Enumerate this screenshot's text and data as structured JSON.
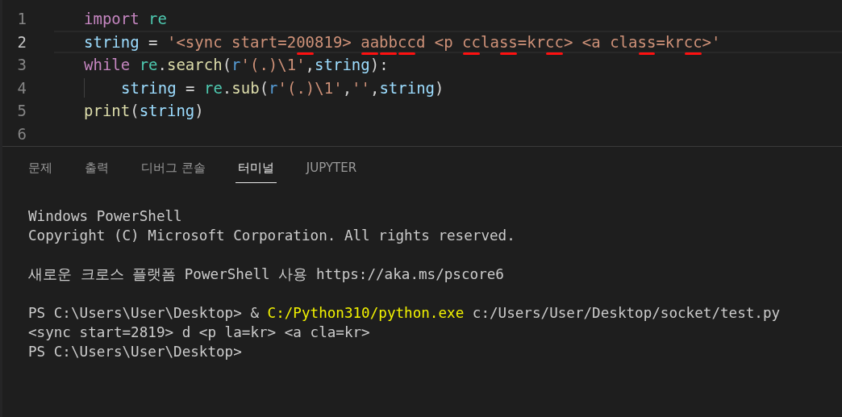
{
  "editor": {
    "lines": [
      {
        "number": "1",
        "current": false,
        "tokens": [
          {
            "text": "import ",
            "kind": "keyword",
            "marked": false
          },
          {
            "text": "re",
            "kind": "module",
            "marked": false
          }
        ]
      },
      {
        "number": "2",
        "current": true,
        "tokens": [
          {
            "text": "string",
            "kind": "variable",
            "marked": false
          },
          {
            "text": " = ",
            "kind": "plain",
            "marked": false
          },
          {
            "text": "'<sync start=2",
            "kind": "string",
            "marked": false
          },
          {
            "text": "00",
            "kind": "string",
            "marked": true
          },
          {
            "text": "819> ",
            "kind": "string",
            "marked": false
          },
          {
            "text": "aa",
            "kind": "string",
            "marked": true
          },
          {
            "text": "bb",
            "kind": "string",
            "marked": true
          },
          {
            "text": "cc",
            "kind": "string",
            "marked": true
          },
          {
            "text": "d <p ",
            "kind": "string",
            "marked": false
          },
          {
            "text": "cc",
            "kind": "string",
            "marked": true
          },
          {
            "text": "la",
            "kind": "string",
            "marked": false
          },
          {
            "text": "ss",
            "kind": "string",
            "marked": true
          },
          {
            "text": "=kr",
            "kind": "string",
            "marked": false
          },
          {
            "text": "cc",
            "kind": "string",
            "marked": true
          },
          {
            "text": "> <a cla",
            "kind": "string",
            "marked": false
          },
          {
            "text": "ss",
            "kind": "string",
            "marked": true
          },
          {
            "text": "=kr",
            "kind": "string",
            "marked": false
          },
          {
            "text": "cc",
            "kind": "string",
            "marked": true
          },
          {
            "text": ">'",
            "kind": "string",
            "marked": false
          }
        ]
      },
      {
        "number": "3",
        "current": false,
        "tokens": [
          {
            "text": "while ",
            "kind": "keyword",
            "marked": false
          },
          {
            "text": "re",
            "kind": "module",
            "marked": false
          },
          {
            "text": ".",
            "kind": "plain",
            "marked": false
          },
          {
            "text": "search",
            "kind": "function",
            "marked": false
          },
          {
            "text": "(",
            "kind": "plain",
            "marked": false
          },
          {
            "text": "r",
            "kind": "prefix",
            "marked": false
          },
          {
            "text": "'(.)\\1'",
            "kind": "string",
            "marked": false
          },
          {
            "text": ",",
            "kind": "plain",
            "marked": false
          },
          {
            "text": "string",
            "kind": "variable",
            "marked": false
          },
          {
            "text": "):",
            "kind": "plain",
            "marked": false
          }
        ],
        "children": [
          {
            "number": "4",
            "current": false,
            "tokens": [
              {
                "text": "string",
                "kind": "variable",
                "marked": false
              },
              {
                "text": " = ",
                "kind": "plain",
                "marked": false
              },
              {
                "text": "re",
                "kind": "module",
                "marked": false
              },
              {
                "text": ".",
                "kind": "plain",
                "marked": false
              },
              {
                "text": "sub",
                "kind": "function",
                "marked": false
              },
              {
                "text": "(",
                "kind": "plain",
                "marked": false
              },
              {
                "text": "r",
                "kind": "prefix",
                "marked": false
              },
              {
                "text": "'(.)\\1'",
                "kind": "string",
                "marked": false
              },
              {
                "text": ",",
                "kind": "plain",
                "marked": false
              },
              {
                "text": "''",
                "kind": "string",
                "marked": false
              },
              {
                "text": ",",
                "kind": "plain",
                "marked": false
              },
              {
                "text": "string",
                "kind": "variable",
                "marked": false
              },
              {
                "text": ")",
                "kind": "plain",
                "marked": false
              }
            ]
          }
        ]
      },
      {
        "number": "5",
        "current": false,
        "tokens": [
          {
            "text": "print",
            "kind": "function",
            "marked": false
          },
          {
            "text": "(",
            "kind": "plain",
            "marked": false
          },
          {
            "text": "string",
            "kind": "variable",
            "marked": false
          },
          {
            "text": ")",
            "kind": "plain",
            "marked": false
          }
        ]
      },
      {
        "number": "6",
        "current": false
      }
    ]
  },
  "panel": {
    "tabs": [
      {
        "label": "문제",
        "selected": false
      },
      {
        "label": "출력",
        "selected": false
      },
      {
        "label": "디버그 콘솔",
        "selected": false
      },
      {
        "label": "터미널",
        "selected": true
      },
      {
        "label": "JUPYTER",
        "selected": false
      }
    ],
    "terminal": {
      "blocks": [
        [
          [
            {
              "text": "Windows PowerShell",
              "kind": "plain"
            }
          ],
          [
            {
              "text": "Copyright (C) Microsoft Corporation. All rights reserved.",
              "kind": "plain"
            }
          ]
        ],
        [
          [
            {
              "text": "새로운 크로스 플랫폼 PowerShell 사용 https://aka.ms/pscore6",
              "kind": "plain"
            }
          ]
        ],
        [
          [
            {
              "text": "PS C:\\Users\\User\\Desktop> & ",
              "kind": "plain"
            },
            {
              "text": "C:/Python310/python.exe",
              "kind": "command"
            },
            {
              "text": " c:/Users/User/Desktop/socket/test.py",
              "kind": "plain"
            }
          ],
          [
            {
              "text": "<sync start=2819> d <p la=kr> <a cla=kr>",
              "kind": "plain"
            }
          ],
          [
            {
              "text": "PS C:\\Users\\User\\Desktop>",
              "kind": "plain"
            }
          ]
        ]
      ]
    }
  }
}
